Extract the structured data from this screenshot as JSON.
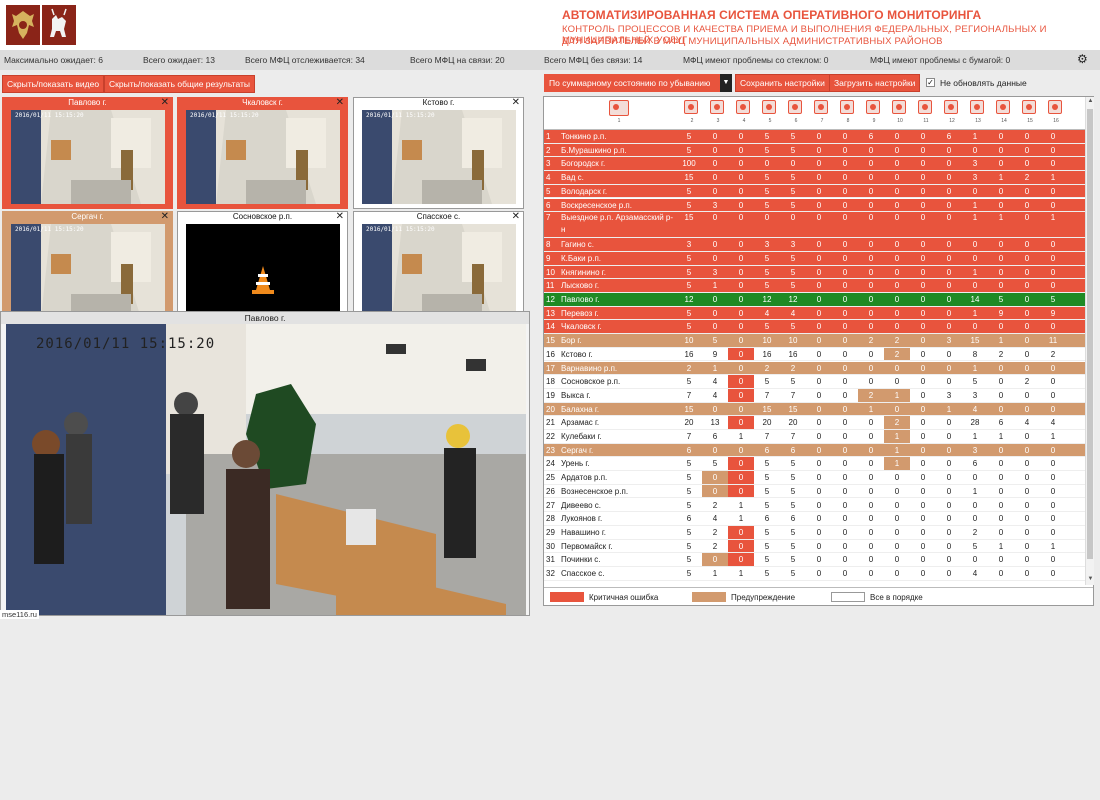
{
  "header": {
    "title": "АВТОМАТИЗИРОВАННАЯ СИСТЕМА ОПЕРАТИВНОГО МОНИТОРИНГА",
    "sub1": "КОНТРОЛЬ ПРОЦЕССОВ И КАЧЕСТВА ПРИЕМА И ВЫПОЛНЕНИЯ ФЕДЕРАЛЬНЫХ, РЕГИОНАЛЬНЫХ И МУНИЦИПАЛЬНЫХ УСЛУГ",
    "sub2": "ДЛЯ ЗАЯВИТЕЛЕЙ В МФЦ МУНИЦИПАЛЬНЫХ АДМИНИСТРАТИВНЫХ РАЙОНОВ"
  },
  "stats": {
    "max_wait": "Максимально ожидает: 6",
    "total_wait": "Всего ожидает: 13",
    "total_tracked": "Всего МФЦ отслеживается: 34",
    "total_online": "Всего МФЦ на связи: 20",
    "total_offline": "Всего МФЦ без связи: 14",
    "glass_problems": "МФЦ имеют проблемы со стеклом: 0",
    "paper_problems": "МФЦ имеют проблемы с бумагой: 0"
  },
  "toolbar": {
    "toggle_video": "Скрыть/показать видео",
    "toggle_results": "Скрыть/показать общие результаты",
    "sort_select": "По суммарному состоянию по убыванию",
    "save_settings": "Сохранить настройки",
    "load_settings": "Загрузить настройки",
    "no_update": "Не обновлять данные"
  },
  "tiles": [
    {
      "title": "Павлово г.",
      "state": "crit",
      "ts": "2016/01/11 15:15:20"
    },
    {
      "title": "Чкаловск г.",
      "state": "crit",
      "ts": "2016/01/11 15:15:20"
    },
    {
      "title": "Кстово г.",
      "state": "normal",
      "ts": "2016/01/11 15:15:20"
    },
    {
      "title": "Сергач г.",
      "state": "warn",
      "ts": "2016/01/11 15:15:20"
    },
    {
      "title": "Сосновское р.п.",
      "state": "normal",
      "ts": ""
    },
    {
      "title": "Спасское с.",
      "state": "normal",
      "ts": "2016/01/11 15:15:20"
    }
  ],
  "popup": {
    "title": "Павлово г.",
    "timestamp": "2016/01/11 15:15:20"
  },
  "status_url": "mse116.ru",
  "table": {
    "col_numbers": [
      "1",
      "2",
      "3",
      "4",
      "5",
      "6",
      "7",
      "8",
      "9",
      "10",
      "11",
      "12",
      "13",
      "14",
      "15",
      "16"
    ],
    "rows": [
      {
        "n": "1",
        "name": "Тонкино р.п.",
        "state": "crit",
        "v": [
          "5",
          "0",
          "0",
          "5",
          "5",
          "0",
          "0",
          "6",
          "0",
          "0",
          "6",
          "1",
          "0",
          "0",
          "0"
        ]
      },
      {
        "n": "2",
        "name": "Б.Мурашкино р.п.",
        "state": "crit",
        "v": [
          "5",
          "0",
          "0",
          "5",
          "5",
          "0",
          "0",
          "0",
          "0",
          "0",
          "0",
          "0",
          "0",
          "0",
          "0"
        ]
      },
      {
        "n": "3",
        "name": "Богородск г.",
        "state": "crit",
        "v": [
          "100",
          "0",
          "0",
          "0",
          "0",
          "0",
          "0",
          "0",
          "0",
          "0",
          "0",
          "3",
          "0",
          "0",
          "0"
        ]
      },
      {
        "n": "4",
        "name": "Вад с.",
        "state": "crit",
        "v": [
          "15",
          "0",
          "0",
          "5",
          "5",
          "0",
          "0",
          "0",
          "0",
          "0",
          "0",
          "3",
          "1",
          "2",
          "1"
        ]
      },
      {
        "n": "5",
        "name": "Володарск г.",
        "state": "crit",
        "v": [
          "5",
          "0",
          "0",
          "5",
          "5",
          "0",
          "0",
          "0",
          "0",
          "0",
          "0",
          "0",
          "0",
          "0",
          "0"
        ]
      },
      {
        "n": "6",
        "name": "Воскресенское р.п.",
        "state": "crit",
        "v": [
          "5",
          "3",
          "0",
          "5",
          "5",
          "0",
          "0",
          "0",
          "0",
          "0",
          "0",
          "1",
          "0",
          "0",
          "0"
        ]
      },
      {
        "n": "7",
        "name": "Выездное р.п. Арзамасский р-н",
        "state": "crit",
        "v": [
          "15",
          "0",
          "0",
          "0",
          "0",
          "0",
          "0",
          "0",
          "0",
          "0",
          "0",
          "1",
          "1",
          "0",
          "1"
        ]
      },
      {
        "n": "8",
        "name": "Гагино с.",
        "state": "crit",
        "v": [
          "3",
          "0",
          "0",
          "3",
          "3",
          "0",
          "0",
          "0",
          "0",
          "0",
          "0",
          "0",
          "0",
          "0",
          "0"
        ]
      },
      {
        "n": "9",
        "name": "К.Баки р.п.",
        "state": "crit",
        "v": [
          "5",
          "0",
          "0",
          "5",
          "5",
          "0",
          "0",
          "0",
          "0",
          "0",
          "0",
          "0",
          "0",
          "0",
          "0"
        ]
      },
      {
        "n": "10",
        "name": "Княгинино г.",
        "state": "crit",
        "v": [
          "5",
          "3",
          "0",
          "5",
          "5",
          "0",
          "0",
          "0",
          "0",
          "0",
          "0",
          "1",
          "0",
          "0",
          "0"
        ]
      },
      {
        "n": "11",
        "name": "Лысково г.",
        "state": "crit",
        "v": [
          "5",
          "1",
          "0",
          "5",
          "5",
          "0",
          "0",
          "0",
          "0",
          "0",
          "0",
          "0",
          "0",
          "0",
          "0"
        ]
      },
      {
        "n": "12",
        "name": "Павлово г.",
        "state": "ok",
        "v": [
          "12",
          "0",
          "0",
          "12",
          "12",
          "0",
          "0",
          "0",
          "0",
          "0",
          "0",
          "14",
          "5",
          "0",
          "5"
        ]
      },
      {
        "n": "13",
        "name": "Перевоз г.",
        "state": "crit",
        "v": [
          "5",
          "0",
          "0",
          "4",
          "4",
          "0",
          "0",
          "0",
          "0",
          "0",
          "0",
          "1",
          "9",
          "0",
          "9"
        ]
      },
      {
        "n": "14",
        "name": "Чкаловск г.",
        "state": "crit",
        "v": [
          "5",
          "0",
          "0",
          "5",
          "5",
          "0",
          "0",
          "0",
          "0",
          "0",
          "0",
          "0",
          "0",
          "0",
          "0"
        ]
      },
      {
        "n": "15",
        "name": "Бор г.",
        "state": "warn",
        "v": [
          "10",
          "5",
          "0",
          "10",
          "10",
          "0",
          "0",
          "2",
          "2",
          "0",
          "3",
          "15",
          "1",
          "0",
          "11"
        ]
      },
      {
        "n": "16",
        "name": "Кстово г.",
        "state": "normal",
        "v": [
          "16",
          "9",
          "0",
          "16",
          "16",
          "0",
          "0",
          "0",
          "2",
          "0",
          "0",
          "8",
          "2",
          "0",
          "2"
        ],
        "h": [
          2
        ],
        "w": [
          8
        ]
      },
      {
        "n": "17",
        "name": "Варнавино р.п.",
        "state": "warn",
        "v": [
          "2",
          "1",
          "0",
          "2",
          "2",
          "0",
          "0",
          "0",
          "0",
          "0",
          "0",
          "1",
          "0",
          "0",
          "0"
        ]
      },
      {
        "n": "18",
        "name": "Сосновское р.п.",
        "state": "normal",
        "v": [
          "5",
          "4",
          "0",
          "5",
          "5",
          "0",
          "0",
          "0",
          "0",
          "0",
          "0",
          "5",
          "0",
          "2",
          "0"
        ],
        "h": [
          2
        ]
      },
      {
        "n": "19",
        "name": "Выкса г.",
        "state": "normal",
        "v": [
          "7",
          "4",
          "0",
          "7",
          "7",
          "0",
          "0",
          "2",
          "1",
          "0",
          "3",
          "3",
          "0",
          "0",
          "0"
        ],
        "h": [
          2
        ],
        "w": [
          7,
          8
        ]
      },
      {
        "n": "20",
        "name": "Балахна г.",
        "state": "warn",
        "v": [
          "15",
          "0",
          "0",
          "15",
          "15",
          "0",
          "0",
          "1",
          "0",
          "0",
          "1",
          "4",
          "0",
          "0",
          "0"
        ]
      },
      {
        "n": "21",
        "name": "Арзамас г.",
        "state": "normal",
        "v": [
          "20",
          "13",
          "0",
          "20",
          "20",
          "0",
          "0",
          "0",
          "2",
          "0",
          "0",
          "28",
          "6",
          "4",
          "4"
        ],
        "h": [
          2
        ],
        "w": [
          8
        ]
      },
      {
        "n": "22",
        "name": "Кулебаки г.",
        "state": "normal",
        "v": [
          "7",
          "6",
          "1",
          "7",
          "7",
          "0",
          "0",
          "0",
          "1",
          "0",
          "0",
          "1",
          "1",
          "0",
          "1"
        ],
        "w": [
          8
        ]
      },
      {
        "n": "23",
        "name": "Сергач г.",
        "state": "warn",
        "v": [
          "6",
          "0",
          "0",
          "6",
          "6",
          "0",
          "0",
          "0",
          "1",
          "0",
          "0",
          "3",
          "0",
          "0",
          "0"
        ]
      },
      {
        "n": "24",
        "name": "Урень г.",
        "state": "normal",
        "v": [
          "5",
          "5",
          "0",
          "5",
          "5",
          "0",
          "0",
          "0",
          "1",
          "0",
          "0",
          "6",
          "0",
          "0",
          "0"
        ],
        "h": [
          2
        ],
        "w": [
          8
        ]
      },
      {
        "n": "25",
        "name": "Ардатов р.п.",
        "state": "normal",
        "v": [
          "5",
          "0",
          "0",
          "5",
          "5",
          "0",
          "0",
          "0",
          "0",
          "0",
          "0",
          "0",
          "0",
          "0",
          "0"
        ],
        "h": [
          2
        ],
        "w": [
          1
        ]
      },
      {
        "n": "26",
        "name": "Вознесенское р.п.",
        "state": "normal",
        "v": [
          "5",
          "0",
          "0",
          "5",
          "5",
          "0",
          "0",
          "0",
          "0",
          "0",
          "0",
          "1",
          "0",
          "0",
          "0"
        ],
        "h": [
          2
        ],
        "w": [
          1
        ]
      },
      {
        "n": "27",
        "name": "Дивеево с.",
        "state": "normal",
        "v": [
          "5",
          "2",
          "1",
          "5",
          "5",
          "0",
          "0",
          "0",
          "0",
          "0",
          "0",
          "0",
          "0",
          "0",
          "0"
        ]
      },
      {
        "n": "28",
        "name": "Лукоянов г.",
        "state": "normal",
        "v": [
          "6",
          "4",
          "1",
          "6",
          "6",
          "0",
          "0",
          "0",
          "0",
          "0",
          "0",
          "0",
          "0",
          "0",
          "0"
        ]
      },
      {
        "n": "29",
        "name": "Навашино г.",
        "state": "normal",
        "v": [
          "5",
          "2",
          "0",
          "5",
          "5",
          "0",
          "0",
          "0",
          "0",
          "0",
          "0",
          "2",
          "0",
          "0",
          "0"
        ],
        "h": [
          2
        ]
      },
      {
        "n": "30",
        "name": "Первомайск г.",
        "state": "normal",
        "v": [
          "5",
          "2",
          "0",
          "5",
          "5",
          "0",
          "0",
          "0",
          "0",
          "0",
          "0",
          "5",
          "1",
          "0",
          "1"
        ],
        "h": [
          2
        ]
      },
      {
        "n": "31",
        "name": "Починки с.",
        "state": "normal",
        "v": [
          "5",
          "0",
          "0",
          "5",
          "5",
          "0",
          "0",
          "0",
          "0",
          "0",
          "0",
          "0",
          "0",
          "0",
          "0"
        ],
        "h": [
          2
        ],
        "w": [
          1
        ]
      },
      {
        "n": "32",
        "name": "Спасское с.",
        "state": "normal",
        "v": [
          "5",
          "1",
          "1",
          "5",
          "5",
          "0",
          "0",
          "0",
          "0",
          "0",
          "0",
          "4",
          "0",
          "0",
          "0"
        ]
      }
    ]
  },
  "legend": {
    "critical": "Критичная ошибка",
    "warning": "Предупреждение",
    "ok": "Все в порядке"
  },
  "colors": {
    "critical": "#e8543d",
    "warning": "#d29a6e",
    "ok": "#1f8a24"
  }
}
